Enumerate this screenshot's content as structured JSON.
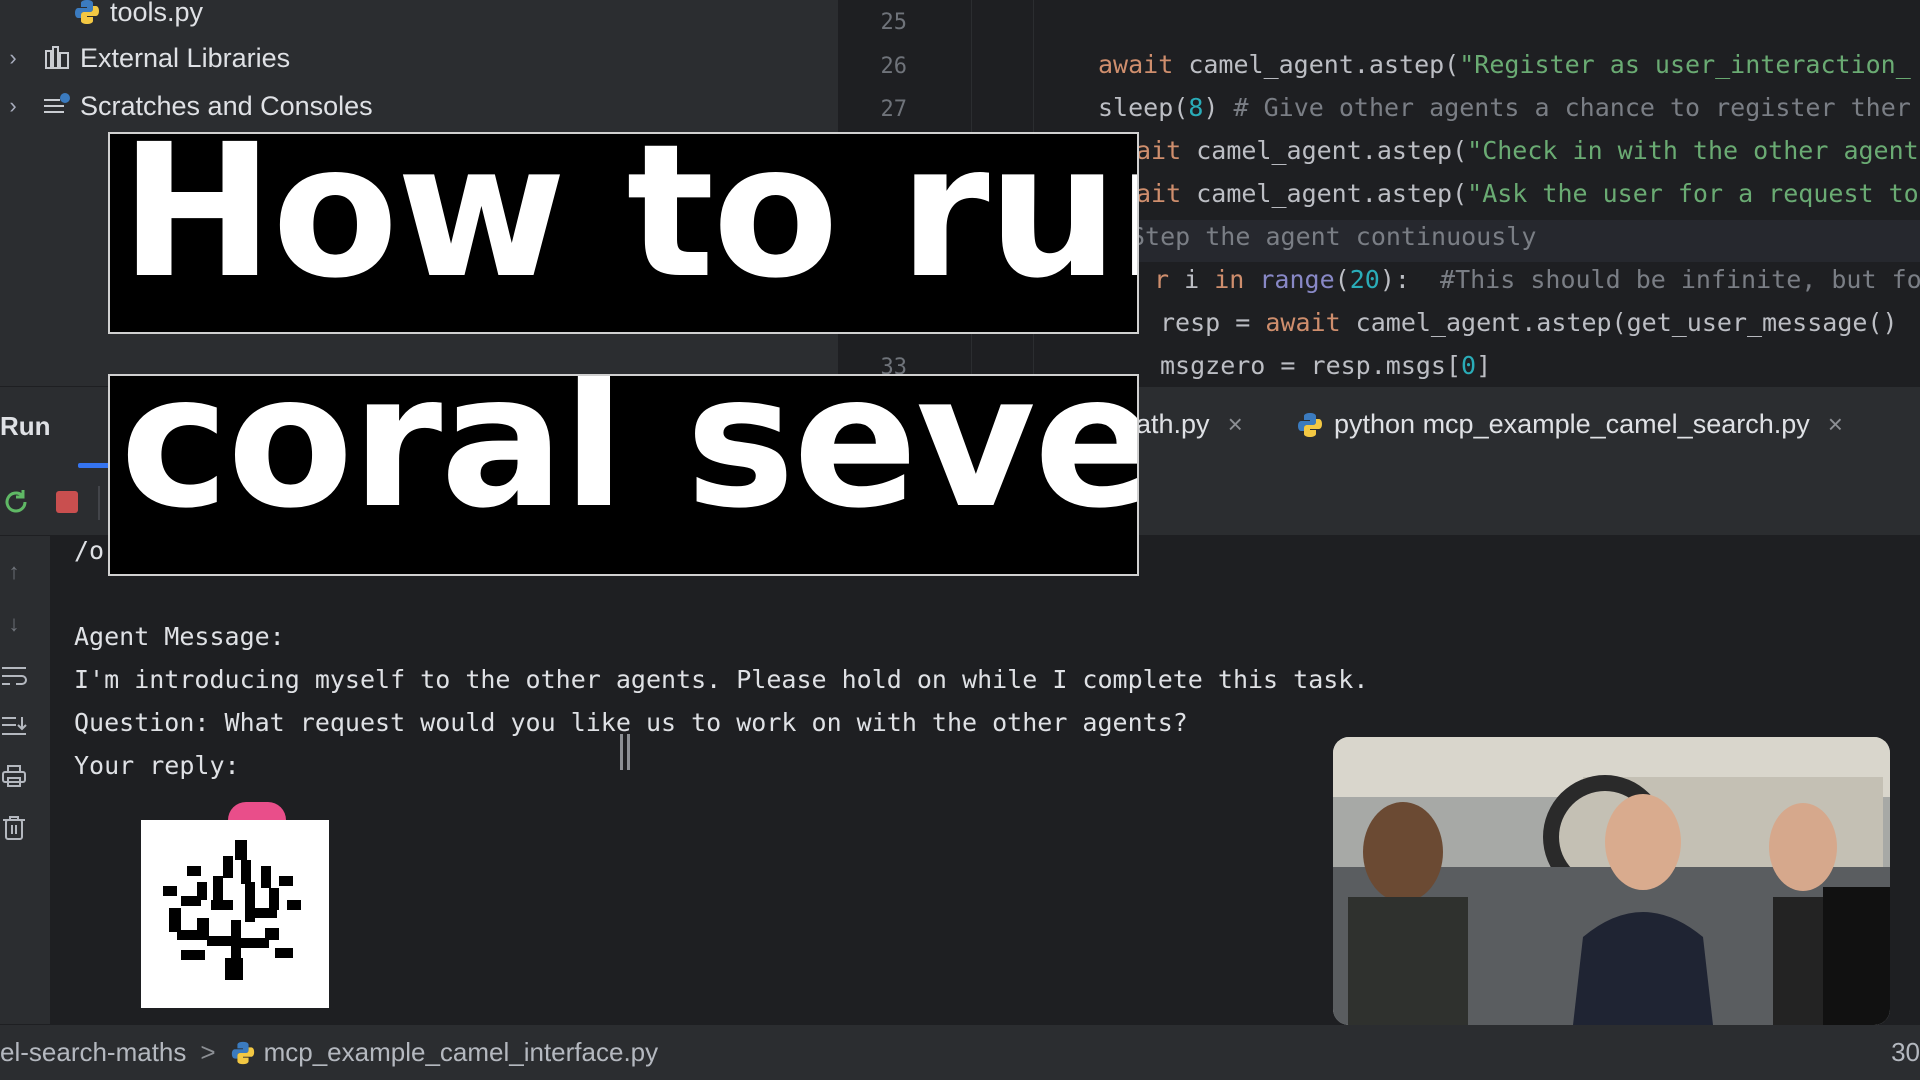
{
  "project_tree": {
    "items": [
      {
        "label": "tools.py",
        "icon": "python-file-icon",
        "expandable": false
      },
      {
        "label": "External Libraries",
        "icon": "library-icon",
        "expandable": true
      },
      {
        "label": "Scratches and Consoles",
        "icon": "scratches-icon",
        "expandable": true
      }
    ]
  },
  "editor": {
    "line_numbers": [
      "25",
      "26",
      "27",
      "33"
    ],
    "lines": [
      {
        "parts": [
          {
            "t": "await ",
            "c": "kw"
          },
          {
            "t": "camel_agent.astep(",
            "c": ""
          },
          {
            "t": "\"Register as user_interaction_",
            "c": "str"
          }
        ]
      },
      {
        "parts": [
          {
            "t": "sleep(",
            "c": ""
          },
          {
            "t": "8",
            "c": "num"
          },
          {
            "t": ") ",
            "c": ""
          },
          {
            "t": "# Give other agents a chance to register ther",
            "c": "cmt"
          }
        ]
      },
      {
        "parts": [
          {
            "t": "ait ",
            "c": "kw"
          },
          {
            "t": "camel_agent.astep(",
            "c": ""
          },
          {
            "t": "\"Check in with the other agent",
            "c": "str"
          }
        ]
      },
      {
        "parts": [
          {
            "t": "ait ",
            "c": "kw"
          },
          {
            "t": "camel_agent.astep(",
            "c": ""
          },
          {
            "t": "\"Ask the user for a request to",
            "c": "str"
          }
        ]
      },
      {
        "parts": [
          {
            "t": "Step the agent continuously",
            "c": "cmt"
          }
        ]
      },
      {
        "parts": [
          {
            "t": "r ",
            "c": "kw"
          },
          {
            "t": "i ",
            "c": ""
          },
          {
            "t": "in ",
            "c": "kw"
          },
          {
            "t": "range",
            "c": "bi"
          },
          {
            "t": "(",
            "c": ""
          },
          {
            "t": "20",
            "c": "num"
          },
          {
            "t": "):  ",
            "c": ""
          },
          {
            "t": "#This should be infinite, but fo",
            "c": "cmt"
          }
        ]
      },
      {
        "parts": [
          {
            "t": "resp = ",
            "c": ""
          },
          {
            "t": "await ",
            "c": "kw"
          },
          {
            "t": "camel_agent.astep(get_user_message()",
            "c": ""
          }
        ]
      },
      {
        "parts": [
          {
            "t": "msgzero = resp.msgs[",
            "c": ""
          },
          {
            "t": "0",
            "c": "num"
          },
          {
            "t": "]",
            "c": ""
          }
        ]
      }
    ]
  },
  "run_panel": {
    "title": "Run",
    "tabs": [
      {
        "label": "ath.py",
        "close": "×"
      },
      {
        "label": "python mcp_example_camel_search.py",
        "close": "×"
      }
    ]
  },
  "console": {
    "lines": [
      "/o",
      "",
      "Agent Message:",
      "I'm introducing myself to the other agents. Please hold on while I complete this task.",
      "Question: What request would you like us to work on with the other agents?",
      "Your reply:"
    ]
  },
  "status_bar": {
    "crumb_1": "el-search-maths",
    "separator": ">",
    "crumb_2": "mcp_example_camel_interface.py",
    "right": "30"
  },
  "overlay": {
    "title_line_1": "How to run",
    "title_line_2": "coral sever"
  },
  "colors": {
    "keyword": "#cf8e6d",
    "string": "#6aab73",
    "number": "#2aacb8",
    "comment": "#7a7e85",
    "accent": "#3574f0",
    "stop_red": "#c94f4f",
    "badge_pink": "#e94e8a"
  }
}
